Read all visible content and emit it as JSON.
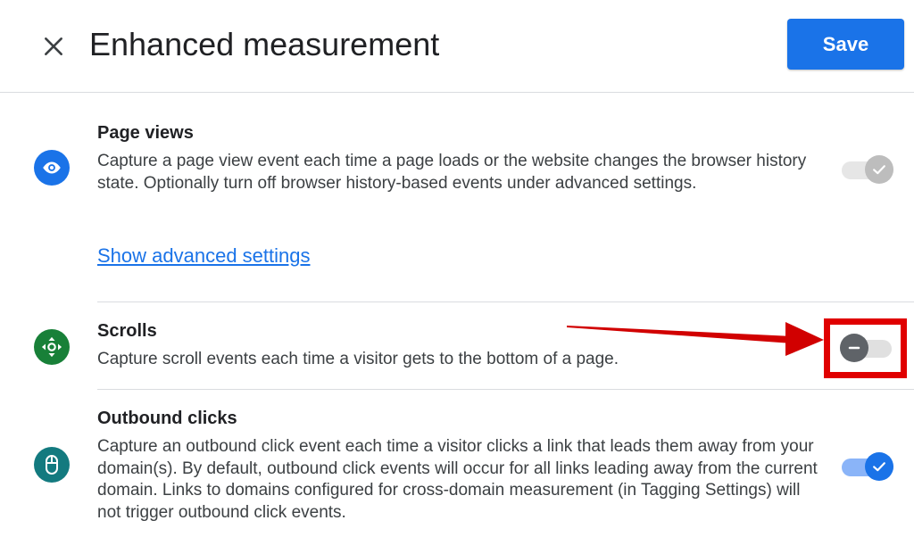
{
  "header": {
    "close_icon": "close-icon",
    "title": "Enhanced measurement",
    "save_label": "Save",
    "save_color": "#1a73e8"
  },
  "items": [
    {
      "icon": "eye-icon",
      "icon_color": "#1a73e8",
      "title": "Page views",
      "description": "Capture a page view event each time a page loads or the website changes the browser history state. Optionally turn off browser history-based events under advanced settings.",
      "link": "Show advanced settings",
      "toggle_state": "on-disabled"
    },
    {
      "icon": "scroll-arrows-icon",
      "icon_color": "#188038",
      "title": "Scrolls",
      "description": "Capture scroll events each time a visitor gets to the bottom of a page.",
      "toggle_state": "off",
      "highlighted": true
    },
    {
      "icon": "mouse-icon",
      "icon_color": "#137a7f",
      "title": "Outbound clicks",
      "description": "Capture an outbound click event each time a visitor clicks a link that leads them away from your domain(s). By default, outbound click events will occur for all links leading away from the current domain. Links to domains configured for cross-domain measurement (in Tagging Settings) will not trigger outbound click events.",
      "toggle_state": "on"
    }
  ],
  "annotation": {
    "color": "#e00000"
  }
}
